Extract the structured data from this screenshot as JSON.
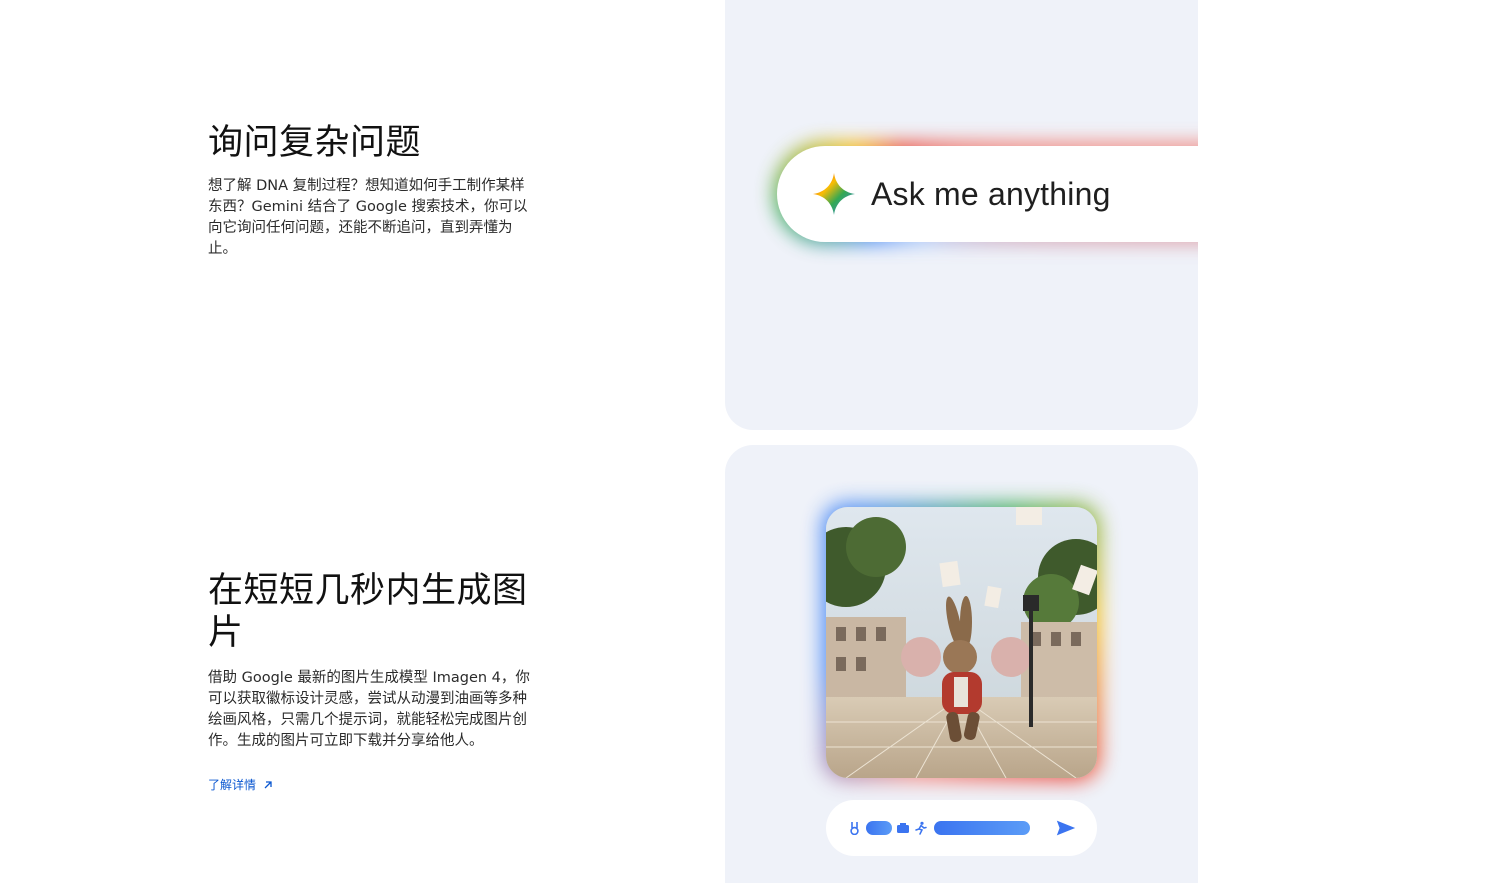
{
  "features": [
    {
      "title": "询问复杂问题",
      "description": "想了解 DNA 复制过程？想知道如何手工制作某样东西？Gemini 结合了 Google 搜索技术，你可以向它询问任何问题，还能不断追问，直到弄懂为止。"
    },
    {
      "title": "在短短几秒内生成图片",
      "description": "借助 Google 最新的图片生成模型 Imagen 4，你可以获取徽标设计灵感，尝试从动漫到油画等多种绘画风格，只需几个提示词，就能轻松完成图片创作。生成的图片可立即下载并分享给他人。",
      "link_label": "了解详情"
    }
  ],
  "ask_bar": {
    "text": "Ask me anything",
    "icon": "gemini-spark-icon"
  },
  "image_card": {
    "image": "rabbit-running-cards-image",
    "prompt_icons": [
      "rabbit-icon",
      "camera-icon",
      "running-icon",
      "send-icon"
    ]
  },
  "colors": {
    "card_bg": "#eff2f9",
    "link": "#0b57d0",
    "accent_blue": "#4285f4"
  }
}
